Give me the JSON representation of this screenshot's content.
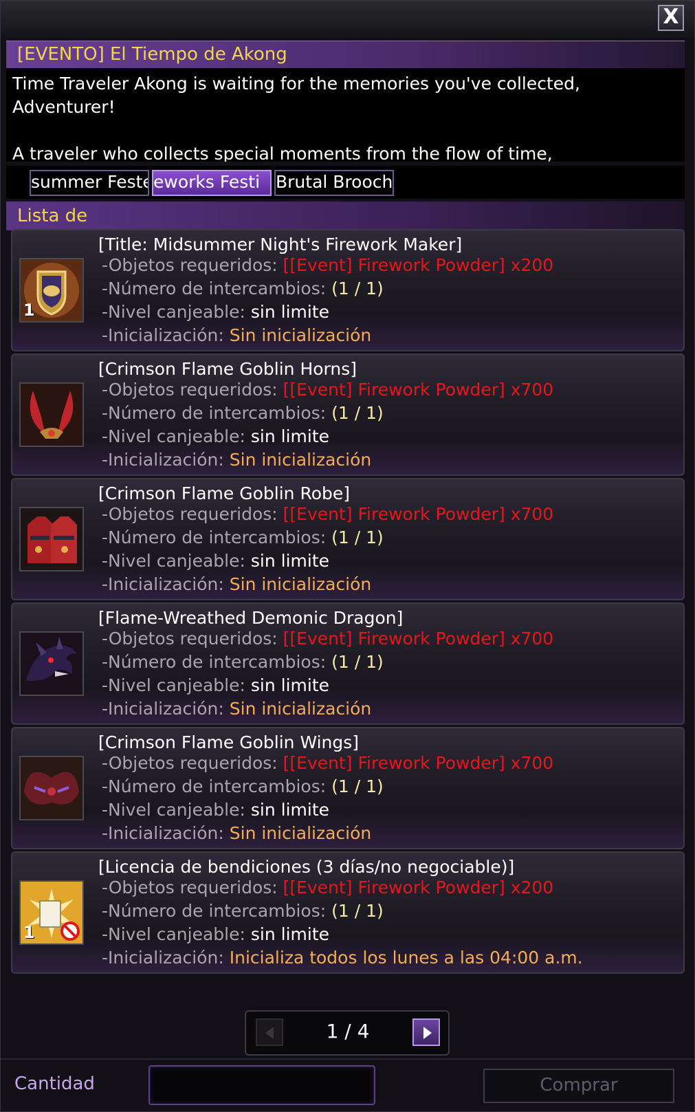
{
  "window": {
    "close_label": "X"
  },
  "event": {
    "title": "[EVENTO] El Tiempo de Akong",
    "description": "Time Traveler Akong is waiting for the memories you've collected,\nAdventurer!\n\nA traveler who collects special moments from the flow of time,"
  },
  "tabs": [
    {
      "label": "summer Feste",
      "active": false
    },
    {
      "label": "eworks Festi",
      "active": true
    },
    {
      "label": "Brutal Brooch",
      "active": false
    }
  ],
  "list": {
    "header": "Lista de",
    "labels": {
      "required": "-Objetos requeridos:",
      "exchanges": "-Número de intercambios:",
      "level": "-Nivel canjeable:",
      "reset": "-Inicialización:"
    },
    "items": [
      {
        "name": "[Title: Midsummer Night's Firework Maker]",
        "required": "[[Event] Firework Powder] x200",
        "exchanges": "(1 / 1)",
        "level": "sin limite",
        "reset": "Sin inicialización",
        "quantity": "1",
        "icon": "title-emblem-icon"
      },
      {
        "name": "[Crimson Flame Goblin Horns]",
        "required": "[[Event] Firework Powder] x700",
        "exchanges": "(1 / 1)",
        "level": "sin limite",
        "reset": "Sin inicialización",
        "quantity": "",
        "icon": "goblin-horns-icon"
      },
      {
        "name": "[Crimson Flame Goblin Robe]",
        "required": "[[Event] Firework Powder] x700",
        "exchanges": "(1 / 1)",
        "level": "sin limite",
        "reset": "Sin inicialización",
        "quantity": "",
        "icon": "goblin-robe-icon"
      },
      {
        "name": "[Flame-Wreathed Demonic Dragon]",
        "required": "[[Event] Firework Powder] x700",
        "exchanges": "(1 / 1)",
        "level": "sin limite",
        "reset": "Sin inicialización",
        "quantity": "",
        "icon": "demonic-dragon-icon"
      },
      {
        "name": "[Crimson Flame Goblin Wings]",
        "required": "[[Event] Firework Powder] x700",
        "exchanges": "(1 / 1)",
        "level": "sin limite",
        "reset": "Sin inicialización",
        "quantity": "",
        "icon": "goblin-wings-icon"
      },
      {
        "name": "[Licencia de bendiciones (3 días/no negociable)]",
        "required": "[[Event] Firework Powder] x200",
        "exchanges": "(1 / 1)",
        "level": "sin limite",
        "reset": "Inicializa todos los lunes a las 04:00 a.m.",
        "quantity": "1",
        "icon": "blessing-license-icon"
      }
    ]
  },
  "pagination": {
    "label": "1 / 4",
    "current": 1,
    "total": 4
  },
  "footer": {
    "quantity_label": "Cantidad",
    "quantity_value": "",
    "buy_label": "Comprar"
  },
  "colors": {
    "accent_purple": "#6a3f96",
    "title_yellow": "#f2d54b",
    "required_red": "#e8161a",
    "reset_orange": "#f4ad50"
  }
}
